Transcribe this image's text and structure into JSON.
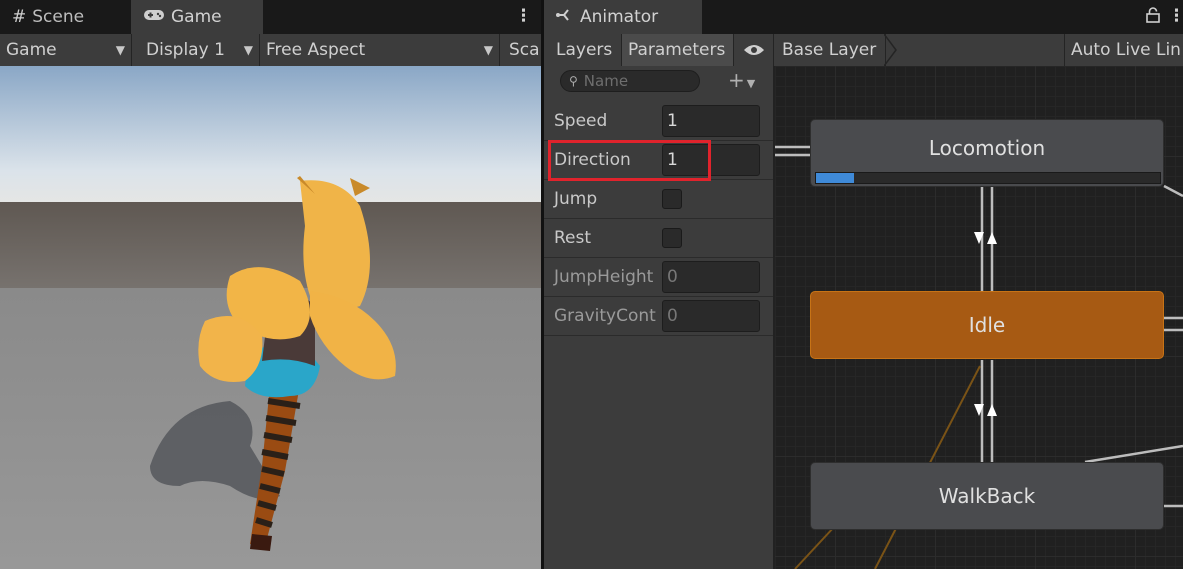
{
  "tabs": {
    "left": [
      {
        "label": "Scene",
        "icon": "hash-icon"
      },
      {
        "label": "Game",
        "icon": "gamepad-icon"
      }
    ],
    "right": [
      {
        "label": "Animator",
        "icon": "animator-icon"
      }
    ]
  },
  "game_toolbar": {
    "mode": "Game",
    "display": "Display 1",
    "aspect": "Free Aspect",
    "scale": "Sca"
  },
  "animator_toolbar": {
    "layers": "Layers",
    "parameters": "Parameters",
    "breadcrumb": "Base Layer",
    "auto_live": "Auto Live Lin"
  },
  "search": {
    "placeholder": "Name"
  },
  "parameters": [
    {
      "name": "Speed",
      "type": "float",
      "value": "1",
      "enabled": true
    },
    {
      "name": "Direction",
      "type": "float",
      "value": "1",
      "enabled": true
    },
    {
      "name": "Jump",
      "type": "bool",
      "value": false,
      "enabled": true
    },
    {
      "name": "Rest",
      "type": "bool",
      "value": false,
      "enabled": true
    },
    {
      "name": "JumpHeight",
      "type": "float",
      "value": "0",
      "enabled": false
    },
    {
      "name": "GravityCont",
      "type": "float",
      "value": "0",
      "enabled": false
    }
  ],
  "states": {
    "locomotion": "Locomotion",
    "idle": "Idle",
    "walkback": "WalkBack"
  },
  "locomotion_progress": 0.11,
  "colors": {
    "accent_orange": "#a75a13",
    "progress_blue": "#3f8ad8",
    "highlight_red": "#e0232c"
  }
}
